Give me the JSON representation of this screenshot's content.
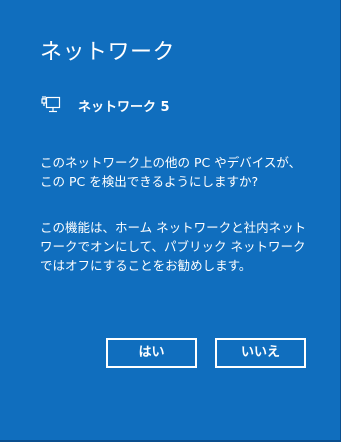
{
  "dialog": {
    "title": "ネットワーク",
    "network_icon": "wired-network-icon",
    "network_name": "ネットワーク 5",
    "question": "このネットワーク上の他の PC やデバイスが、この PC を検出できるようにしますか?",
    "description": "この機能は、ホーム ネットワークと社内ネットワークでオンにして、パブリック ネットワークではオフにすることをお勧めします。",
    "yes_label": "はい",
    "no_label": "いいえ"
  },
  "colors": {
    "background": "#106ebe",
    "text": "#ffffff",
    "button_border": "#ffffff"
  }
}
